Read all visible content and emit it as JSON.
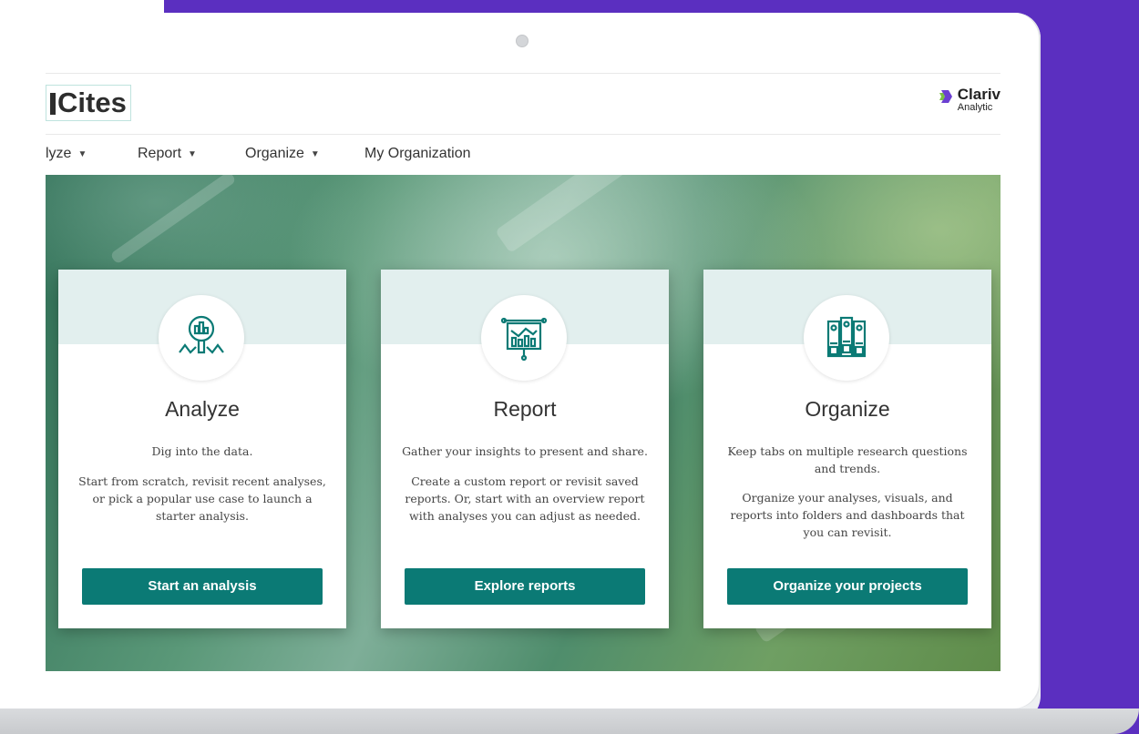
{
  "header": {
    "app_name": "Cites",
    "brand_name": "Clariv",
    "brand_sub": "Analytic"
  },
  "nav": {
    "items": [
      {
        "label": "lyze",
        "has_dropdown": true
      },
      {
        "label": "Report",
        "has_dropdown": true
      },
      {
        "label": "Organize",
        "has_dropdown": true
      },
      {
        "label": "My Organization",
        "has_dropdown": false
      }
    ]
  },
  "cards": [
    {
      "icon": "magnifier-chart-icon",
      "title": "Analyze",
      "lead": "Dig into the data.",
      "description": "Start from scratch, revisit recent analyses, or pick a popular use case to launch a starter analysis.",
      "button": "Start an analysis"
    },
    {
      "icon": "presentation-board-icon",
      "title": "Report",
      "lead": "Gather your insights to present and share.",
      "description": "Create a custom report or revisit saved reports. Or, start with an overview report with analyses you can adjust as needed.",
      "button": "Explore reports"
    },
    {
      "icon": "binders-icon",
      "title": "Organize",
      "lead": "Keep tabs on multiple research questions and trends.",
      "description": "Organize your analyses, visuals, and reports into folders and dashboards that you can revisit.",
      "button": "Organize your projects"
    }
  ],
  "colors": {
    "accent": "#0b7a75",
    "purple_bg": "#5b2fc0",
    "card_top": "#e2efee"
  }
}
